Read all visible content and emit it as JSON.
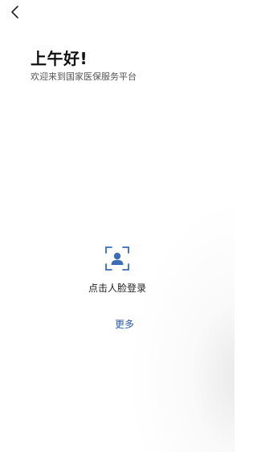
{
  "colors": {
    "brand_blue": "#2a5aa6",
    "face_blue": "#3a6cb8",
    "text_dark": "#111111",
    "text_muted": "#555555"
  },
  "icons": {
    "back": "chevron-left-icon",
    "face_login": "face-scan-icon"
  },
  "header": {
    "greeting": "上午好!",
    "welcome_text": "欢迎来到国家医保服务平台"
  },
  "face_login": {
    "label": "点击人脸登录"
  },
  "footer": {
    "more_label": "更多"
  }
}
